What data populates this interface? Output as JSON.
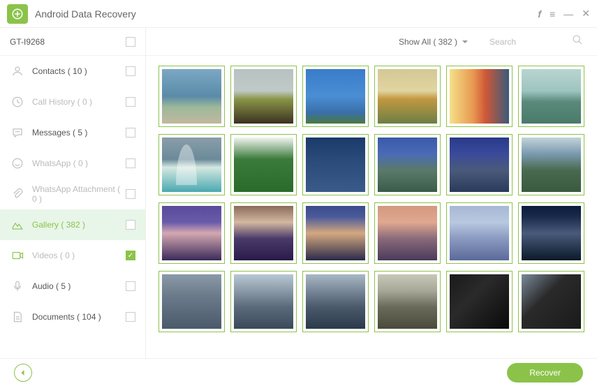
{
  "app": {
    "title": "Android Data Recovery"
  },
  "device": {
    "name": "GT-I9268"
  },
  "categories": [
    {
      "label": "Contacts ( 10 )",
      "icon": "contacts",
      "enabled": true,
      "active": false,
      "checked": false
    },
    {
      "label": "Call History ( 0 )",
      "icon": "clock",
      "enabled": false,
      "active": false,
      "checked": false
    },
    {
      "label": "Messages ( 5 )",
      "icon": "messages",
      "enabled": true,
      "active": false,
      "checked": false
    },
    {
      "label": "WhatsApp ( 0 )",
      "icon": "whatsapp",
      "enabled": false,
      "active": false,
      "checked": false
    },
    {
      "label": "WhatsApp Attachment ( 0 )",
      "icon": "attachment",
      "enabled": false,
      "active": false,
      "checked": false
    },
    {
      "label": "Gallery ( 382 )",
      "icon": "gallery",
      "enabled": true,
      "active": true,
      "checked": false
    },
    {
      "label": "Videos ( 0 )",
      "icon": "videos",
      "enabled": false,
      "active": false,
      "checked": true
    },
    {
      "label": "Audio ( 5 )",
      "icon": "audio",
      "enabled": true,
      "active": false,
      "checked": false
    },
    {
      "label": "Documents ( 104 )",
      "icon": "documents",
      "enabled": true,
      "active": false,
      "checked": false
    }
  ],
  "toolbar": {
    "filter_label": "Show All ( 382 )",
    "search_placeholder": "Search"
  },
  "thumbs": [
    [
      "t1",
      "t2",
      "t3",
      "t4",
      "t5",
      "t6"
    ],
    [
      "t7",
      "t8",
      "t9",
      "t10",
      "t11",
      "t12"
    ],
    [
      "t13",
      "t14",
      "t15",
      "t16",
      "t17",
      "t18"
    ],
    [
      "t19",
      "t20",
      "t21",
      "t22",
      "t23",
      "t24"
    ]
  ],
  "footer": {
    "recover_label": "Recover"
  },
  "colors": {
    "accent": "#8bc34a"
  }
}
